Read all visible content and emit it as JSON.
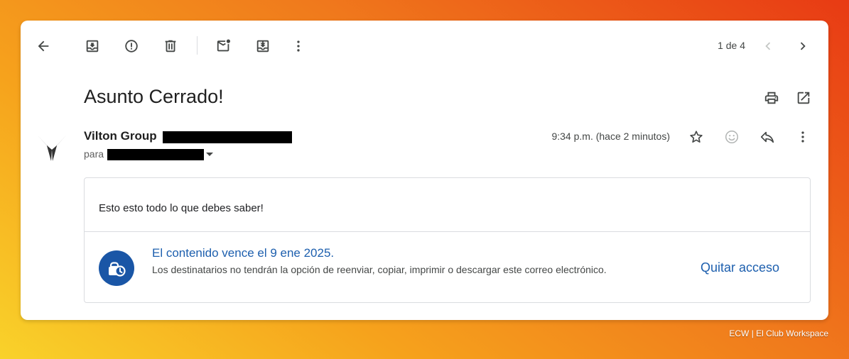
{
  "toolbar": {
    "back_icon": "arrow-left-icon",
    "archive_icon": "archive-icon",
    "spam_icon": "report-spam-icon",
    "delete_icon": "trash-icon",
    "mark_unread_icon": "mark-unread-icon",
    "move_icon": "move-to-inbox-icon",
    "more_icon": "more-vert-icon"
  },
  "pager": {
    "text": "1 de 4"
  },
  "email": {
    "subject": "Asunto Cerrado!",
    "sender_name": "Vilton Group",
    "to_label": "para",
    "time": "9:34 p.m. (hace 2 minutos)",
    "body": "Esto esto todo lo que debes saber!"
  },
  "confidential": {
    "title": "El contenido vence el 9 ene 2025.",
    "description": "Los destinatarios no tendrán la opción de reenviar, copiar, imprimir o descargar este correo electrónico.",
    "revoke_label": "Quitar acceso"
  },
  "credit": "ECW | El Club Workspace",
  "colors": {
    "accent": "#1d5fae",
    "redaction": "#000000"
  }
}
